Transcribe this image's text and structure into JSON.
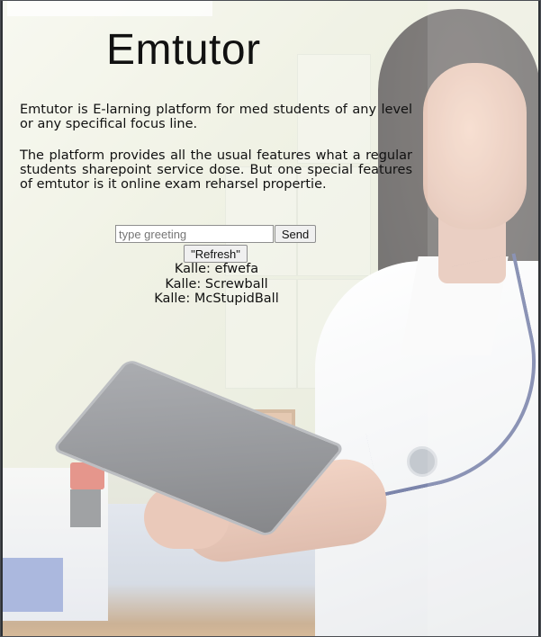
{
  "page": {
    "title": "Emtutor",
    "paragraphs": [
      "Emtutor is E-larning platform for med students of any level or any specifical focus line.",
      "The platform provides all the usual features what a regular students sharepoint service dose. But one special features of emtutor is it online exam reharsel propertie."
    ]
  },
  "chat": {
    "input_placeholder": "type greeting",
    "input_value": "",
    "send_label": "Send",
    "refresh_label": "\"Refresh\"",
    "messages": [
      "Kalle: efwefa",
      "Kalle: Screwball",
      "Kalle: McStupidBall"
    ]
  }
}
